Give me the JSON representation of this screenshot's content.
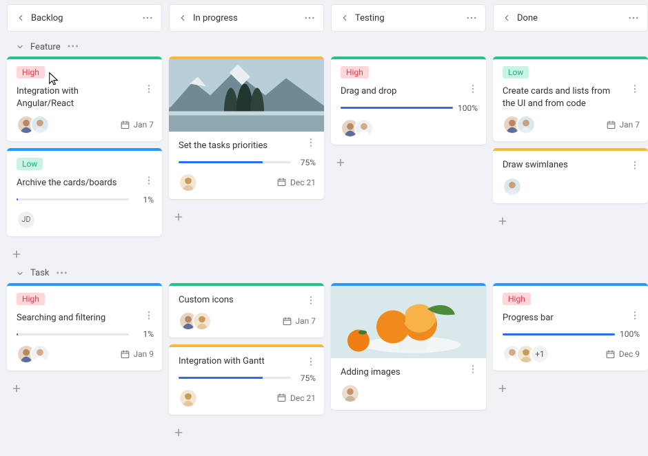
{
  "columns": [
    {
      "id": "backlog",
      "title": "Backlog"
    },
    {
      "id": "inprogress",
      "title": "In progress"
    },
    {
      "id": "testing",
      "title": "Testing"
    },
    {
      "id": "done",
      "title": "Done"
    }
  ],
  "swimlanes": [
    {
      "id": "feature",
      "label": "Feature"
    },
    {
      "id": "task",
      "label": "Task"
    }
  ],
  "accent": {
    "green": "#29c18b",
    "blue": "#2d97f3",
    "yellow": "#f6b83d"
  },
  "priority": {
    "high": "High",
    "low": "Low"
  },
  "cards": {
    "feature": {
      "backlog": [
        {
          "accent": "green",
          "priority": "high",
          "title": "Integration with Angular/React",
          "date": "Jan 7",
          "avatars": [
            "a",
            "b"
          ]
        },
        {
          "accent": "blue",
          "priority": "low",
          "title": "Archive the cards/boards",
          "progress": 1,
          "avatars_initial": [
            "JD"
          ]
        }
      ],
      "inprogress": [
        {
          "accent": "yellow",
          "cover": "mountain",
          "title": "Set the tasks priorities",
          "progress": 75,
          "date": "Dec 21",
          "avatars": [
            "c"
          ]
        }
      ],
      "testing": [
        {
          "accent": "green",
          "priority": "high",
          "title": "Drag and drop",
          "progress": 100,
          "avatars": [
            "a",
            "d"
          ]
        }
      ],
      "done": [
        {
          "accent": "green",
          "priority": "low",
          "title": "Create cards and lists from the UI and from code",
          "date": "Jan 7",
          "avatars": [
            "a",
            "b"
          ]
        },
        {
          "accent": "yellow",
          "title": "Draw swimlanes",
          "avatars": [
            "b"
          ]
        }
      ]
    },
    "task": {
      "backlog": [
        {
          "accent": "blue",
          "priority": "high",
          "title": "Searching and filtering",
          "progress": 1,
          "date": "Jan 9",
          "avatars": [
            "a",
            "d"
          ]
        }
      ],
      "inprogress": [
        {
          "accent": "green",
          "title": "Custom icons",
          "date": "Jan 7",
          "avatars": [
            "a",
            "c"
          ]
        },
        {
          "accent": "yellow",
          "title": "Integration with Gantt",
          "progress": 75,
          "date": "Dec 21",
          "avatars": [
            "c"
          ]
        }
      ],
      "testing": [
        {
          "accent": "blue",
          "cover": "oranges",
          "title": "Adding images",
          "avatars": [
            "e"
          ]
        }
      ],
      "done": [
        {
          "accent": "blue",
          "priority": "high",
          "title": "Progress bar",
          "progress": 100,
          "date": "Dec 9",
          "avatars": [
            "d",
            "c"
          ],
          "more_count": "+1"
        }
      ]
    }
  }
}
